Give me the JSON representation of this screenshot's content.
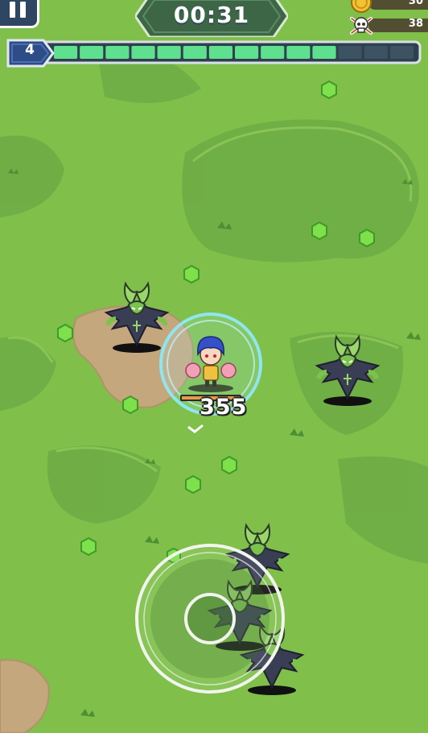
{
  "hud": {
    "timer": "00:31",
    "coins": "30",
    "kills": "38",
    "level": "4",
    "xp_fraction": 0.79,
    "xp_segments_total": 14,
    "xp_segments_filled": 11
  },
  "combat": {
    "damage_number": "355"
  },
  "colors": {
    "grass": "#7fbf4a",
    "grass_dark": "#5f9e3d",
    "dirt": "#c5a77e",
    "gem": "#7ee04a",
    "xp_fill": "#5fe08f",
    "shield_ring": "#8fe6f0",
    "hp_bar": "#e79a4a"
  },
  "icons": {
    "pause": "pause-icon",
    "coin": "coin-icon",
    "kills": "skull-crossbones-icon",
    "gem": "green-gem-icon",
    "joystick": "virtual-joystick"
  }
}
